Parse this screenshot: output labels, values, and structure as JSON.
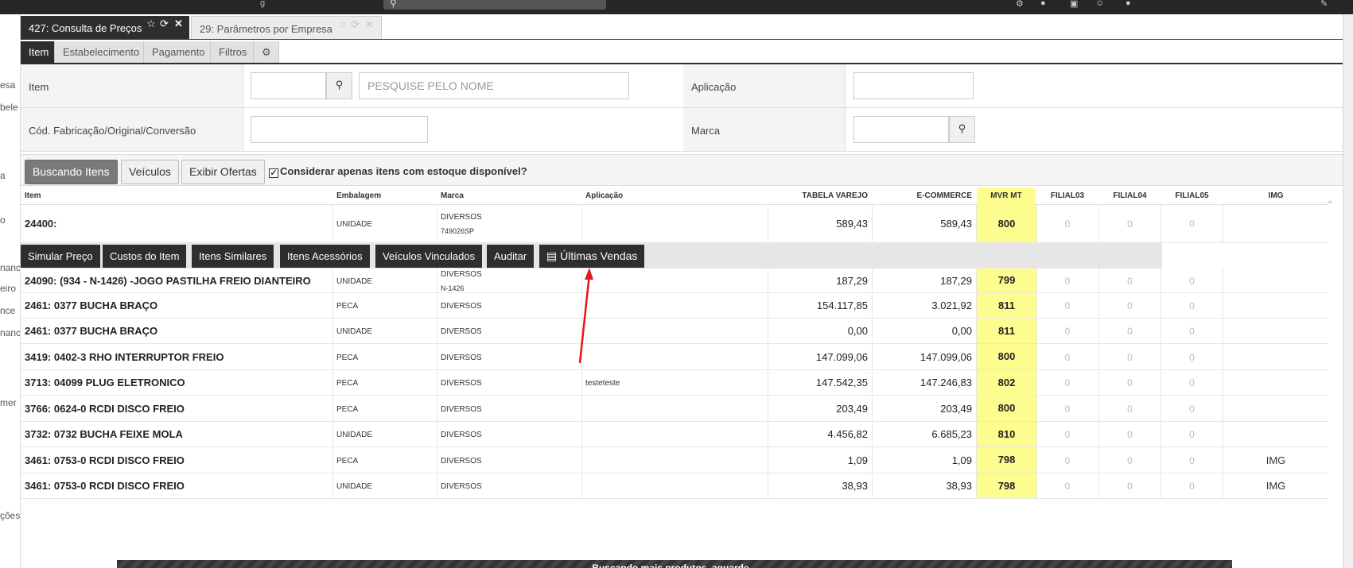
{
  "window_tabs": [
    {
      "label": "427: Consulta de Preços",
      "active": true
    },
    {
      "label": "29: Parâmetros por Empresa",
      "active": false
    }
  ],
  "sub_tabs": [
    "Item",
    "Estabelecimento",
    "Pagamento",
    "Filtros"
  ],
  "form": {
    "item_label": "Item",
    "item_name_placeholder": "PESQUISE PELO NOME",
    "aplicacao_label": "Aplicação",
    "cod_label": "Cód. Fabricação/Original/Conversão",
    "marca_label": "Marca"
  },
  "toolbar": {
    "buscando": "Buscando Itens",
    "veiculos": "Veículos",
    "exibir_ofertas": "Exibir Ofertas",
    "checkbox_label": "Considerar apenas itens com estoque disponível?",
    "checkbox_mark": "✓"
  },
  "columns": {
    "item": "Item",
    "embalagem": "Embalagem",
    "marca": "Marca",
    "aplicacao": "Aplicação",
    "tabela_varejo": "TABELA VAREJO",
    "ecommerce": "E-COMMERCE",
    "mvr_mt": "MVR MT",
    "filial03": "FILIAL03",
    "filial04": "FILIAL04",
    "filial05": "FILIAL05",
    "img": "IMG"
  },
  "rows": [
    {
      "item": "24400:",
      "embalagem": "UNIDADE",
      "marca": "DIVERSOS",
      "marca2": "749026SP",
      "aplicacao": "",
      "tabela": "589,43",
      "ecommerce": "589,43",
      "mvr": "800",
      "f03": "0",
      "f04": "0",
      "f05": "0",
      "img": ""
    },
    {
      "item": "24090: (934 - N-1426) -JOGO PASTILHA FREIO DIANTEIRO",
      "embalagem": "UNIDADE",
      "marca": "DIVERSOS",
      "marca2": "N-1426",
      "aplicacao": "",
      "tabela": "187,29",
      "ecommerce": "187,29",
      "mvr": "799",
      "f03": "0",
      "f04": "0",
      "f05": "0",
      "img": ""
    },
    {
      "item": "2461: 0377 BUCHA BRAÇO",
      "embalagem": "PECA",
      "marca": "DIVERSOS",
      "marca2": "",
      "aplicacao": "",
      "tabela": "154.117,85",
      "ecommerce": "3.021,92",
      "mvr": "811",
      "f03": "0",
      "f04": "0",
      "f05": "0",
      "img": ""
    },
    {
      "item": "2461: 0377 BUCHA BRAÇO",
      "embalagem": "UNIDADE",
      "marca": "DIVERSOS",
      "marca2": "",
      "aplicacao": "",
      "tabela": "0,00",
      "ecommerce": "0,00",
      "mvr": "811",
      "f03": "0",
      "f04": "0",
      "f05": "0",
      "img": ""
    },
    {
      "item": "3419: 0402-3 RHO INTERRUPTOR FREIO",
      "embalagem": "PECA",
      "marca": "DIVERSOS",
      "marca2": "",
      "aplicacao": "",
      "tabela": "147.099,06",
      "ecommerce": "147.099,06",
      "mvr": "800",
      "f03": "0",
      "f04": "0",
      "f05": "0",
      "img": ""
    },
    {
      "item": "3713: 04099 PLUG ELETRONICO",
      "embalagem": "PECA",
      "marca": "DIVERSOS",
      "marca2": "",
      "aplicacao": "testeteste",
      "tabela": "147.542,35",
      "ecommerce": "147.246,83",
      "mvr": "802",
      "f03": "0",
      "f04": "0",
      "f05": "0",
      "img": ""
    },
    {
      "item": "3766: 0624-0 RCDI DISCO FREIO",
      "embalagem": "PECA",
      "marca": "DIVERSOS",
      "marca2": "",
      "aplicacao": "",
      "tabela": "203,49",
      "ecommerce": "203,49",
      "mvr": "800",
      "f03": "0",
      "f04": "0",
      "f05": "0",
      "img": ""
    },
    {
      "item": "3732: 0732 BUCHA FEIXE MOLA",
      "embalagem": "UNIDADE",
      "marca": "DIVERSOS",
      "marca2": "",
      "aplicacao": "",
      "tabela": "4.456,82",
      "ecommerce": "6.685,23",
      "mvr": "810",
      "f03": "0",
      "f04": "0",
      "f05": "0",
      "img": ""
    },
    {
      "item": "3461: 0753-0 RCDI DISCO FREIO",
      "embalagem": "PECA",
      "marca": "DIVERSOS",
      "marca2": "",
      "aplicacao": "",
      "tabela": "1,09",
      "ecommerce": "1,09",
      "mvr": "798",
      "f03": "0",
      "f04": "0",
      "f05": "0",
      "img": "IMG"
    },
    {
      "item": "3461: 0753-0 RCDI DISCO FREIO",
      "embalagem": "UNIDADE",
      "marca": "DIVERSOS",
      "marca2": "",
      "aplicacao": "",
      "tabela": "38,93",
      "ecommerce": "38,93",
      "mvr": "798",
      "f03": "0",
      "f04": "0",
      "f05": "0",
      "img": "IMG"
    }
  ],
  "row_actions": [
    "Simular Preço",
    "Custos do Item",
    "Itens Similares",
    "Itens Acessórios",
    "Veículos Vinculados",
    "Auditar",
    "Últimas Vendas"
  ],
  "left_strip": [
    "esa",
    "bele",
    "a",
    "o",
    "nanc",
    "eiro",
    "nce",
    "nanc",
    "mer",
    "ções"
  ],
  "bottom_message": "Buscando mais produtos, aguarde...",
  "colors": {
    "accent_dark": "#2e2e2e",
    "mvr_yellow": "#fdfd8f",
    "arrow_red": "#e8141c"
  }
}
